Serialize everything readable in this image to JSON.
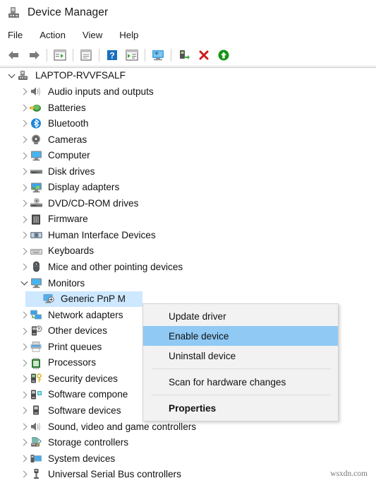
{
  "window": {
    "title": "Device Manager",
    "app_icon": "device-manager-icon"
  },
  "menubar": {
    "items": [
      {
        "label": "File"
      },
      {
        "label": "Action"
      },
      {
        "label": "View"
      },
      {
        "label": "Help"
      }
    ]
  },
  "toolbar": {
    "buttons": [
      {
        "icon": "back-arrow-icon",
        "tooltip": "Back"
      },
      {
        "icon": "forward-arrow-icon",
        "tooltip": "Forward"
      },
      {
        "icon": "show-hide-console-tree-icon",
        "tooltip": "Show/Hide console tree"
      },
      {
        "icon": "properties-icon",
        "tooltip": "Properties"
      },
      {
        "icon": "help-icon",
        "tooltip": "Help"
      },
      {
        "icon": "show-hide-action-pane-icon",
        "tooltip": "Show/Hide action pane"
      },
      {
        "icon": "scan-hardware-changes-icon",
        "tooltip": "Scan for hardware changes"
      },
      {
        "icon": "enable-device-icon",
        "tooltip": "Enable device"
      },
      {
        "icon": "uninstall-device-icon",
        "tooltip": "Uninstall device"
      },
      {
        "icon": "update-driver-icon",
        "tooltip": "Update driver"
      }
    ]
  },
  "tree": {
    "root": {
      "label": "LAPTOP-RVVFSALF",
      "icon": "computer-node-icon",
      "expanded": true
    },
    "items": [
      {
        "label": "Audio inputs and outputs",
        "icon": "speaker-icon",
        "expanded": false,
        "depth": 1
      },
      {
        "label": "Batteries",
        "icon": "battery-icon",
        "expanded": false,
        "depth": 1
      },
      {
        "label": "Bluetooth",
        "icon": "bluetooth-icon",
        "expanded": false,
        "depth": 1
      },
      {
        "label": "Cameras",
        "icon": "camera-icon",
        "expanded": false,
        "depth": 1
      },
      {
        "label": "Computer",
        "icon": "monitor-icon",
        "expanded": false,
        "depth": 1
      },
      {
        "label": "Disk drives",
        "icon": "disk-drive-icon",
        "expanded": false,
        "depth": 1
      },
      {
        "label": "Display adapters",
        "icon": "display-adapter-icon",
        "expanded": false,
        "depth": 1
      },
      {
        "label": "DVD/CD-ROM drives",
        "icon": "optical-drive-icon",
        "expanded": false,
        "depth": 1
      },
      {
        "label": "Firmware",
        "icon": "firmware-icon",
        "expanded": false,
        "depth": 1
      },
      {
        "label": "Human Interface Devices",
        "icon": "hid-icon",
        "expanded": false,
        "depth": 1
      },
      {
        "label": "Keyboards",
        "icon": "keyboard-icon",
        "expanded": false,
        "depth": 1
      },
      {
        "label": "Mice and other pointing devices",
        "icon": "mouse-icon",
        "expanded": false,
        "depth": 1
      },
      {
        "label": "Monitors",
        "icon": "monitor-icon",
        "expanded": true,
        "depth": 1
      },
      {
        "label": "Generic PnP M",
        "icon": "generic-monitor-icon",
        "expanded": null,
        "depth": 2,
        "selected": true
      },
      {
        "label": "Network adapters",
        "icon": "network-adapter-icon",
        "expanded": false,
        "depth": 1
      },
      {
        "label": "Other devices",
        "icon": "other-device-icon",
        "expanded": false,
        "depth": 1
      },
      {
        "label": "Print queues",
        "icon": "printer-icon",
        "expanded": false,
        "depth": 1
      },
      {
        "label": "Processors",
        "icon": "processor-icon",
        "expanded": false,
        "depth": 1
      },
      {
        "label": "Security devices",
        "icon": "security-device-icon",
        "expanded": false,
        "depth": 1
      },
      {
        "label": "Software compone",
        "icon": "software-component-icon",
        "expanded": false,
        "depth": 1
      },
      {
        "label": "Software devices",
        "icon": "software-device-icon",
        "expanded": false,
        "depth": 1
      },
      {
        "label": "Sound, video and game controllers",
        "icon": "speaker-icon",
        "expanded": false,
        "depth": 1
      },
      {
        "label": "Storage controllers",
        "icon": "storage-controller-icon",
        "expanded": false,
        "depth": 1
      },
      {
        "label": "System devices",
        "icon": "system-device-icon",
        "expanded": false,
        "depth": 1
      },
      {
        "label": "Universal Serial Bus controllers",
        "icon": "usb-controller-icon",
        "expanded": false,
        "depth": 1
      }
    ]
  },
  "context_menu": {
    "items": [
      {
        "label": "Update driver",
        "type": "item",
        "highlighted": false,
        "bold": false
      },
      {
        "label": "Enable device",
        "type": "item",
        "highlighted": true,
        "bold": false
      },
      {
        "label": "Uninstall device",
        "type": "item",
        "highlighted": false,
        "bold": false
      },
      {
        "type": "separator"
      },
      {
        "label": "Scan for hardware changes",
        "type": "item",
        "highlighted": false,
        "bold": false
      },
      {
        "type": "separator"
      },
      {
        "label": "Properties",
        "type": "item",
        "highlighted": false,
        "bold": true
      }
    ]
  },
  "watermark": {
    "text": "wsxdn.com"
  },
  "colors": {
    "selection_blue": "#cde8ff",
    "menu_highlight_blue": "#8fc9f4",
    "menu_background": "#f2f2f2",
    "toolbar_red": "#cc1b1b",
    "toolbar_green": "#149414"
  }
}
